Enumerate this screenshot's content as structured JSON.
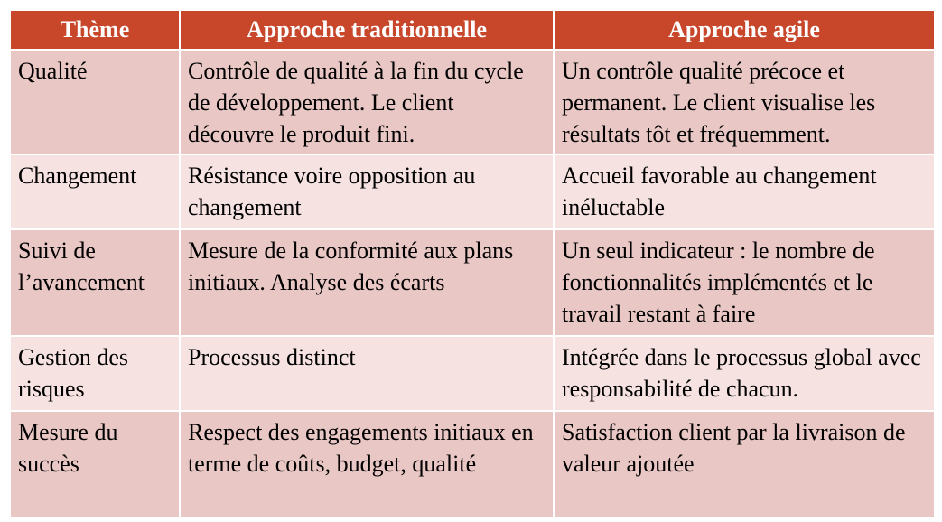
{
  "table": {
    "headers": [
      "Thème",
      "Approche traditionnelle",
      "Approche agile"
    ],
    "rows": [
      [
        "Qualité",
        "Contrôle de qualité à la fin du cycle de développement. Le client découvre le produit fini.",
        "Un contrôle qualité précoce et permanent. Le client visualise les résultats tôt et fréquemment."
      ],
      [
        "Changement",
        "Résistance voire opposition au changement",
        "Accueil favorable au changement inéluctable"
      ],
      [
        "Suivi de l’avancement",
        "Mesure de la conformité aux plans initiaux. Analyse des écarts",
        "Un seul indicateur : le nombre de fonctionnalités implémentés et le travail restant à faire"
      ],
      [
        "Gestion des risques",
        "Processus distinct",
        "Intégrée dans le processus global avec responsabilité de chacun."
      ],
      [
        "Mesure du succès",
        "Respect des engagements initiaux en terme de coûts, budget, qualité",
        "Satisfaction client par la livraison de valeur ajoutée"
      ]
    ]
  },
  "colors": {
    "header_bg": "#c8472b",
    "header_text": "#ffffff",
    "row_dark": "#e9c7c4",
    "row_light": "#f5e2e1"
  }
}
